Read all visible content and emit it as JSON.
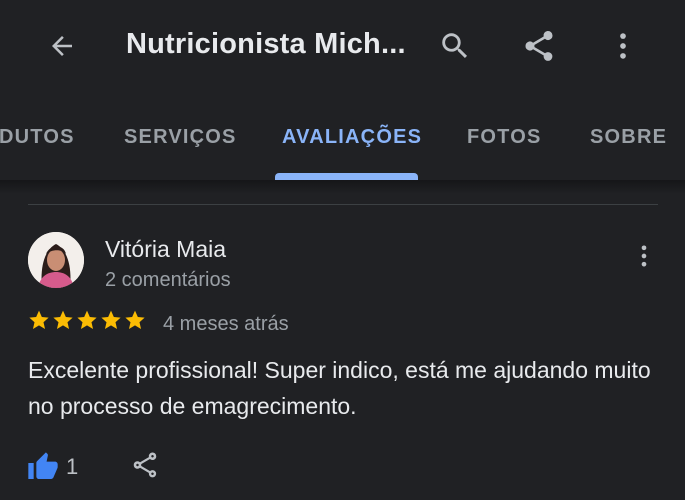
{
  "header": {
    "title": "Nutricionista Mich...",
    "icons": [
      "back-arrow-icon",
      "search-icon",
      "share-icon",
      "more-vert-icon"
    ]
  },
  "tabs": [
    {
      "label": "DUTOS"
    },
    {
      "label": "SERVIÇOS"
    },
    {
      "label": "AVALIAÇÕES",
      "active": true
    },
    {
      "label": "FOTOS"
    },
    {
      "label": "SOBRE"
    }
  ],
  "review": {
    "reviewer_name": "Vitória Maia",
    "reviewer_meta": "2 comentários",
    "rating": 5,
    "time": "4 meses atrás",
    "text": "Excelente profissional! Super indico, está me ajudando muito no processo de emagrecimento.",
    "likes": "1"
  },
  "colors": {
    "background": "#202124",
    "accent": "#8ab4f8",
    "star": "#fbbc04",
    "like_icon": "#4285f4"
  }
}
